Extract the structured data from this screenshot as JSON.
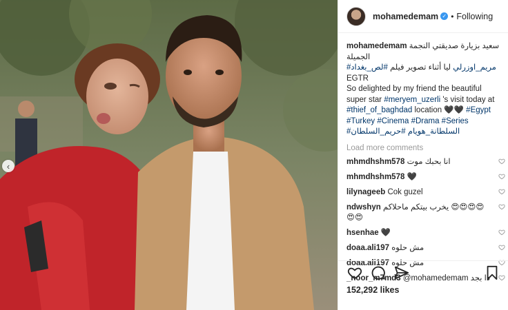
{
  "post": {
    "username": "mohamedemam",
    "verified_mark": "✓",
    "separator": "•",
    "follow_status": "Following",
    "caption": {
      "user": "mohamedemam",
      "line1": "سعيد بزيارة صديقتي النجمة الجميلة",
      "hashtag_ar1": "#مريم_اوزرلي",
      "line2_mid": "ليا أثناء تصوير فيلم",
      "hashtag_ar2": "#لص_بغداد",
      "line2_tag": "EGTR",
      "en_1": "So delighted by my friend the beautiful super star ",
      "mention": "#meryem_uzerli",
      "en_2": " 's visit today at ",
      "tag_thief": "#thief_of_baghdad",
      "en_3": " location ",
      "hearts": "🖤🖤",
      "tag_egypt": "#Egypt",
      "tag_turkey": "#Turkey",
      "tag_cinema": "#Cinema",
      "tag_drama": "#Drama",
      "tag_series": "#Series",
      "tag_ar3": "#السلطانة_هويام",
      "tag_ar4": "#حريم_السلطان"
    },
    "load_more": "Load more comments",
    "comments": [
      {
        "user": "mhmdhshm578",
        "text": "انا بحبك موت"
      },
      {
        "user": "mhmdhshm578",
        "text": "🖤"
      },
      {
        "user": "lilynageeb",
        "text": "Cok guzel"
      },
      {
        "user": "ndwshyn",
        "text": "يخرب بيتكم ماحلاكم 😍😍😍😍 😍😍"
      },
      {
        "user": "hsenhae",
        "text": "🖤"
      },
      {
        "user": "doaa.ali197",
        "text": "مش حلوه"
      },
      {
        "user": "doaa.ali197",
        "text": "مش حلوه"
      },
      {
        "user": "_noor_m7md3",
        "text": "@mohamedemam دا بجد"
      }
    ],
    "likes": "152,292 likes"
  },
  "icons": {
    "carousel_prev": "chevron-left-icon",
    "like": "heart-outline-icon",
    "comment": "speech-bubble-icon",
    "share": "paper-plane-icon",
    "save": "bookmark-icon",
    "comment_like": "small-heart-icon"
  },
  "colors": {
    "link": "#003569",
    "verified": "#3897f0",
    "muted": "#999999",
    "text": "#262626"
  }
}
